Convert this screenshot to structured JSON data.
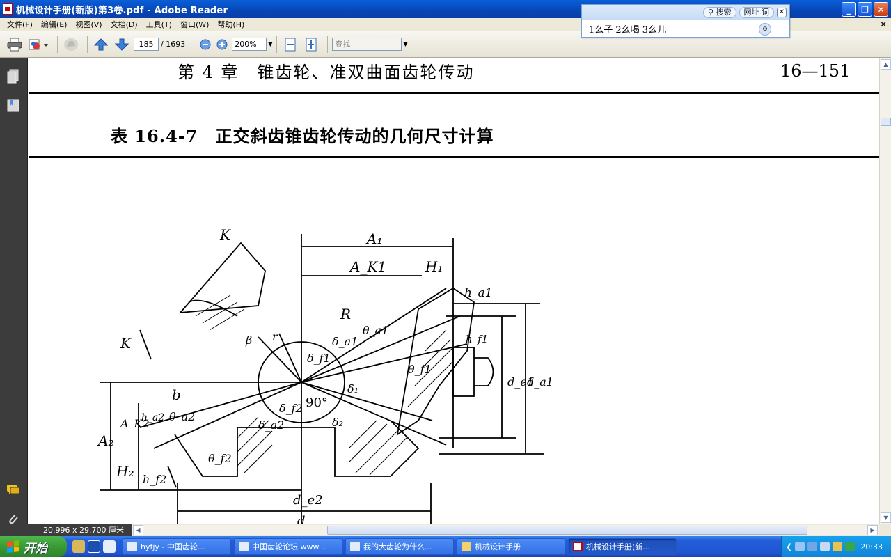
{
  "window": {
    "title": "机械设计手册(新版)第3卷.pdf - Adobe Reader"
  },
  "menu": [
    "文件(F)",
    "编辑(E)",
    "视图(V)",
    "文档(D)",
    "工具(T)",
    "窗口(W)",
    "帮助(H)"
  ],
  "toolbar": {
    "page_current": "185",
    "page_total": "/ 1693",
    "zoom": "200%",
    "find_placeholder": "查找"
  },
  "search_popup": {
    "search_label": "搜索",
    "url_label": "网址",
    "word_label": "词",
    "suggestions": "1么子 2么喝 3么儿"
  },
  "document": {
    "chapter": "第 4 章　锥齿轮、准双曲面齿轮传动",
    "page_number": "16—151",
    "table_title": "表 16.4-7　正交斜齿锥齿轮传动的几何尺寸计算",
    "labels": {
      "K_top": "K",
      "K_left": "K",
      "A1": "A₁",
      "AK1": "A_K1",
      "H1": "H₁",
      "ha1": "h_a1",
      "hf1": "h_f1",
      "R": "R",
      "theta_a1": "θ_a1",
      "theta_f1": "θ_f1",
      "beta": "β",
      "r": "r",
      "delta_a1": "δ_a1",
      "delta_f1": "δ_f1",
      "delta_1": "δ₁",
      "delta_f2": "δ_f2",
      "delta_a2": "δ_a2",
      "delta_2": "δ₂",
      "angle90": "90°",
      "b": "b",
      "theta_a2": "θ_a2",
      "theta_f2": "θ_f2",
      "ha2": "h_a2",
      "hf2": "h_f2",
      "A2": "A₂",
      "AK2": "A_K2",
      "H2": "H₂",
      "de1": "d_e1",
      "da1": "d_a1",
      "de2": "d_e2",
      "da2": "d"
    }
  },
  "status": {
    "page_size": "20.996 x 29.700 厘米"
  },
  "taskbar": {
    "start": "开始",
    "tasks": [
      {
        "label": "hyfjy - 中国齿轮...",
        "active": false
      },
      {
        "label": "中国齿轮论坛 www...",
        "active": false
      },
      {
        "label": "我的大齿轮为什么...",
        "active": false
      },
      {
        "label": "机械设计手册",
        "active": false
      },
      {
        "label": "机械设计手册(新...",
        "active": true
      }
    ],
    "clock": "20:33"
  },
  "colors": {
    "titlebar": "#0846b6",
    "navpanel": "#3c3c3c",
    "taskbar": "#245edb",
    "start": "#3a9a35"
  }
}
